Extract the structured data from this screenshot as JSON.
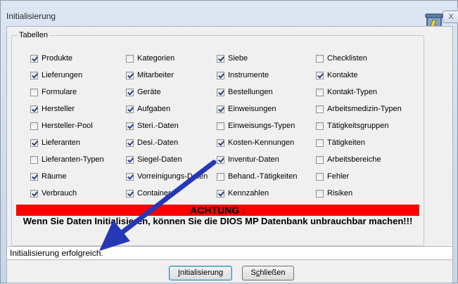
{
  "window": {
    "title": "Initialisierung",
    "close_label": "X"
  },
  "group": {
    "title": "Tabellen"
  },
  "checkboxes": [
    {
      "label": "Produkte",
      "checked": true
    },
    {
      "label": "Kategorien",
      "checked": false
    },
    {
      "label": "Siebe",
      "checked": true
    },
    {
      "label": "Checklisten",
      "checked": false
    },
    {
      "label": "Lieferungen",
      "checked": true
    },
    {
      "label": "Mitarbeiter",
      "checked": true
    },
    {
      "label": "Instrumente",
      "checked": true
    },
    {
      "label": "Kontakte",
      "checked": true
    },
    {
      "label": "Formulare",
      "checked": false
    },
    {
      "label": "Geräte",
      "checked": true
    },
    {
      "label": "Bestellungen",
      "checked": true
    },
    {
      "label": "Kontakt-Typen",
      "checked": false
    },
    {
      "label": "Hersteller",
      "checked": true
    },
    {
      "label": "Aufgaben",
      "checked": true
    },
    {
      "label": "Einweisungen",
      "checked": true
    },
    {
      "label": "Arbeitsmedizin-Typen",
      "checked": false
    },
    {
      "label": "Hersteller-Pool",
      "checked": false
    },
    {
      "label": "Steri.-Daten",
      "checked": true
    },
    {
      "label": "Einweisungs-Typen",
      "checked": false
    },
    {
      "label": "Tätigkeitsgruppen",
      "checked": false
    },
    {
      "label": "Lieferanten",
      "checked": true
    },
    {
      "label": "Desi.-Daten",
      "checked": true
    },
    {
      "label": "Kosten-Kennungen",
      "checked": true
    },
    {
      "label": "Tätigkeiten",
      "checked": false
    },
    {
      "label": "Lieferanten-Typen",
      "checked": false
    },
    {
      "label": "Siegel-Daten",
      "checked": true
    },
    {
      "label": "Inventur-Daten",
      "checked": true
    },
    {
      "label": "Arbeitsbereiche",
      "checked": false
    },
    {
      "label": "Räume",
      "checked": true
    },
    {
      "label": "Vorreinigungs-Daten",
      "checked": true
    },
    {
      "label": "Behand.-Tätigkeiten",
      "checked": false
    },
    {
      "label": "Fehler",
      "checked": false
    },
    {
      "label": "Verbrauch",
      "checked": true
    },
    {
      "label": "Container",
      "checked": true
    },
    {
      "label": "Kennzahlen",
      "checked": true
    },
    {
      "label": "Risiken",
      "checked": false
    }
  ],
  "warning": {
    "heading": "ACHTUNG :",
    "message": "Wenn Sie Daten Initialisieren, können Sie die DIOS MP Datenbank unbrauchbar machen!!!"
  },
  "status": {
    "text": "Initialisierung erfolgreich."
  },
  "buttons": {
    "init": {
      "mnemonic": "I",
      "rest": "nitialisierung"
    },
    "close": {
      "pre": "S",
      "mnemonic": "c",
      "rest": "hließen"
    }
  },
  "colors": {
    "warning_red": "#ff0000",
    "annotation_arrow": "#2438b8"
  },
  "icons": {
    "side": "trash-can-icon",
    "annotation": "arrow-annotation"
  }
}
